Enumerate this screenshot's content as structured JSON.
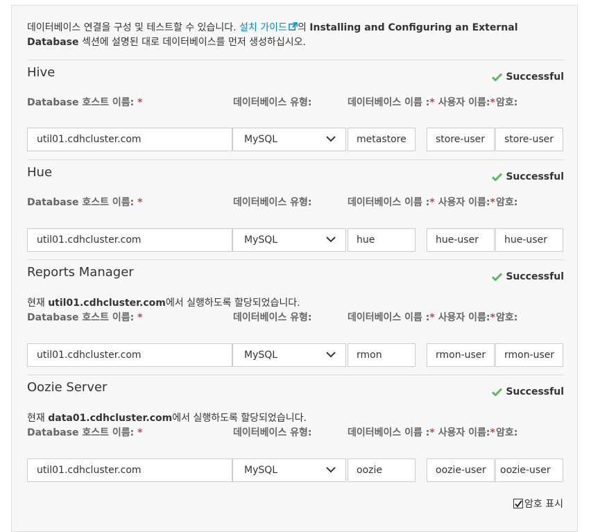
{
  "intro": {
    "text_before": "데이터베이스 연결을 구성 및 테스트할 수 있습니다. ",
    "link": "설치 가이드",
    "text_after": "의 ",
    "bold": "Installing and Configuring an External Database",
    "text_end": " 섹션에 설명된 대로 데이터베이스를 먼저 생성하십시오."
  },
  "labels": {
    "host": "Database 호스트 이름:",
    "type": "데이터베이스 유형:",
    "name": "데이터베이스 이름 :",
    "user": "사용자 이름:",
    "pass": "암호:",
    "required": "*"
  },
  "sections": [
    {
      "title": "Hive",
      "status": "Successful",
      "assign_pre": "",
      "assign_host": "",
      "assign_post": "",
      "host": "util01.cdhcluster.com",
      "type": "MySQL",
      "name": "metastore",
      "user": "store-user",
      "pass": "store-user"
    },
    {
      "title": "Hue",
      "status": "Successful",
      "assign_pre": "",
      "assign_host": "",
      "assign_post": "",
      "host": "util01.cdhcluster.com",
      "type": "MySQL",
      "name": "hue",
      "user": "hue-user",
      "pass": "hue-user"
    },
    {
      "title": "Reports Manager",
      "status": "Successful",
      "assign_pre": "현재 ",
      "assign_host": "util01.cdhcluster.com",
      "assign_post": "에서 실행하도록 할당되었습니다.",
      "host": "util01.cdhcluster.com",
      "type": "MySQL",
      "name": "rmon",
      "user": "rmon-user",
      "pass": "rmon-user"
    },
    {
      "title": "Oozie Server",
      "status": "Successful",
      "assign_pre": "현재 ",
      "assign_host": "data01.cdhcluster.com",
      "assign_post": "에서 실행하도록 할당되었습니다.",
      "host": "util01.cdhcluster.com",
      "type": "MySQL",
      "name": "oozie",
      "user": "oozie-user",
      "pass": "oozie-user"
    }
  ],
  "show_password": {
    "label": "암호 표시",
    "checked": true
  },
  "colors": {
    "link": "#0088cc",
    "success": "#5cb85c",
    "required": "#b94a48"
  }
}
